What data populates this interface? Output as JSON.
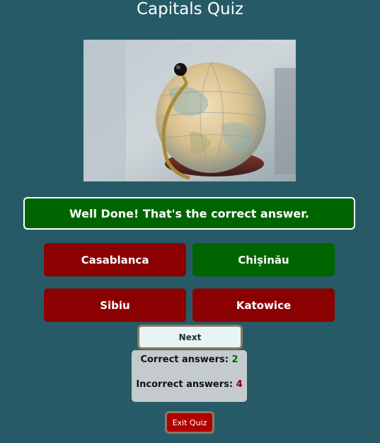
{
  "header": {
    "title": "Capitals Quiz"
  },
  "image": {
    "name": "globe-photo"
  },
  "feedback": {
    "text": "Well Done! That's the correct answer."
  },
  "answers": [
    {
      "label": "Casablanca",
      "status": "wrong"
    },
    {
      "label": "Chișinău",
      "status": "correct"
    },
    {
      "label": "Sibiu",
      "status": "wrong"
    },
    {
      "label": "Katowice",
      "status": "wrong"
    }
  ],
  "buttons": {
    "next_label": "Next",
    "exit_label": "Exit Quiz"
  },
  "score": {
    "correct_label": "Correct answers:",
    "correct_value": "2",
    "incorrect_label": "Incorrect answers:",
    "incorrect_value": "4"
  },
  "colors": {
    "background": "#275a67",
    "correct": "#006400",
    "wrong": "#8b0000",
    "exit": "#b00000"
  }
}
